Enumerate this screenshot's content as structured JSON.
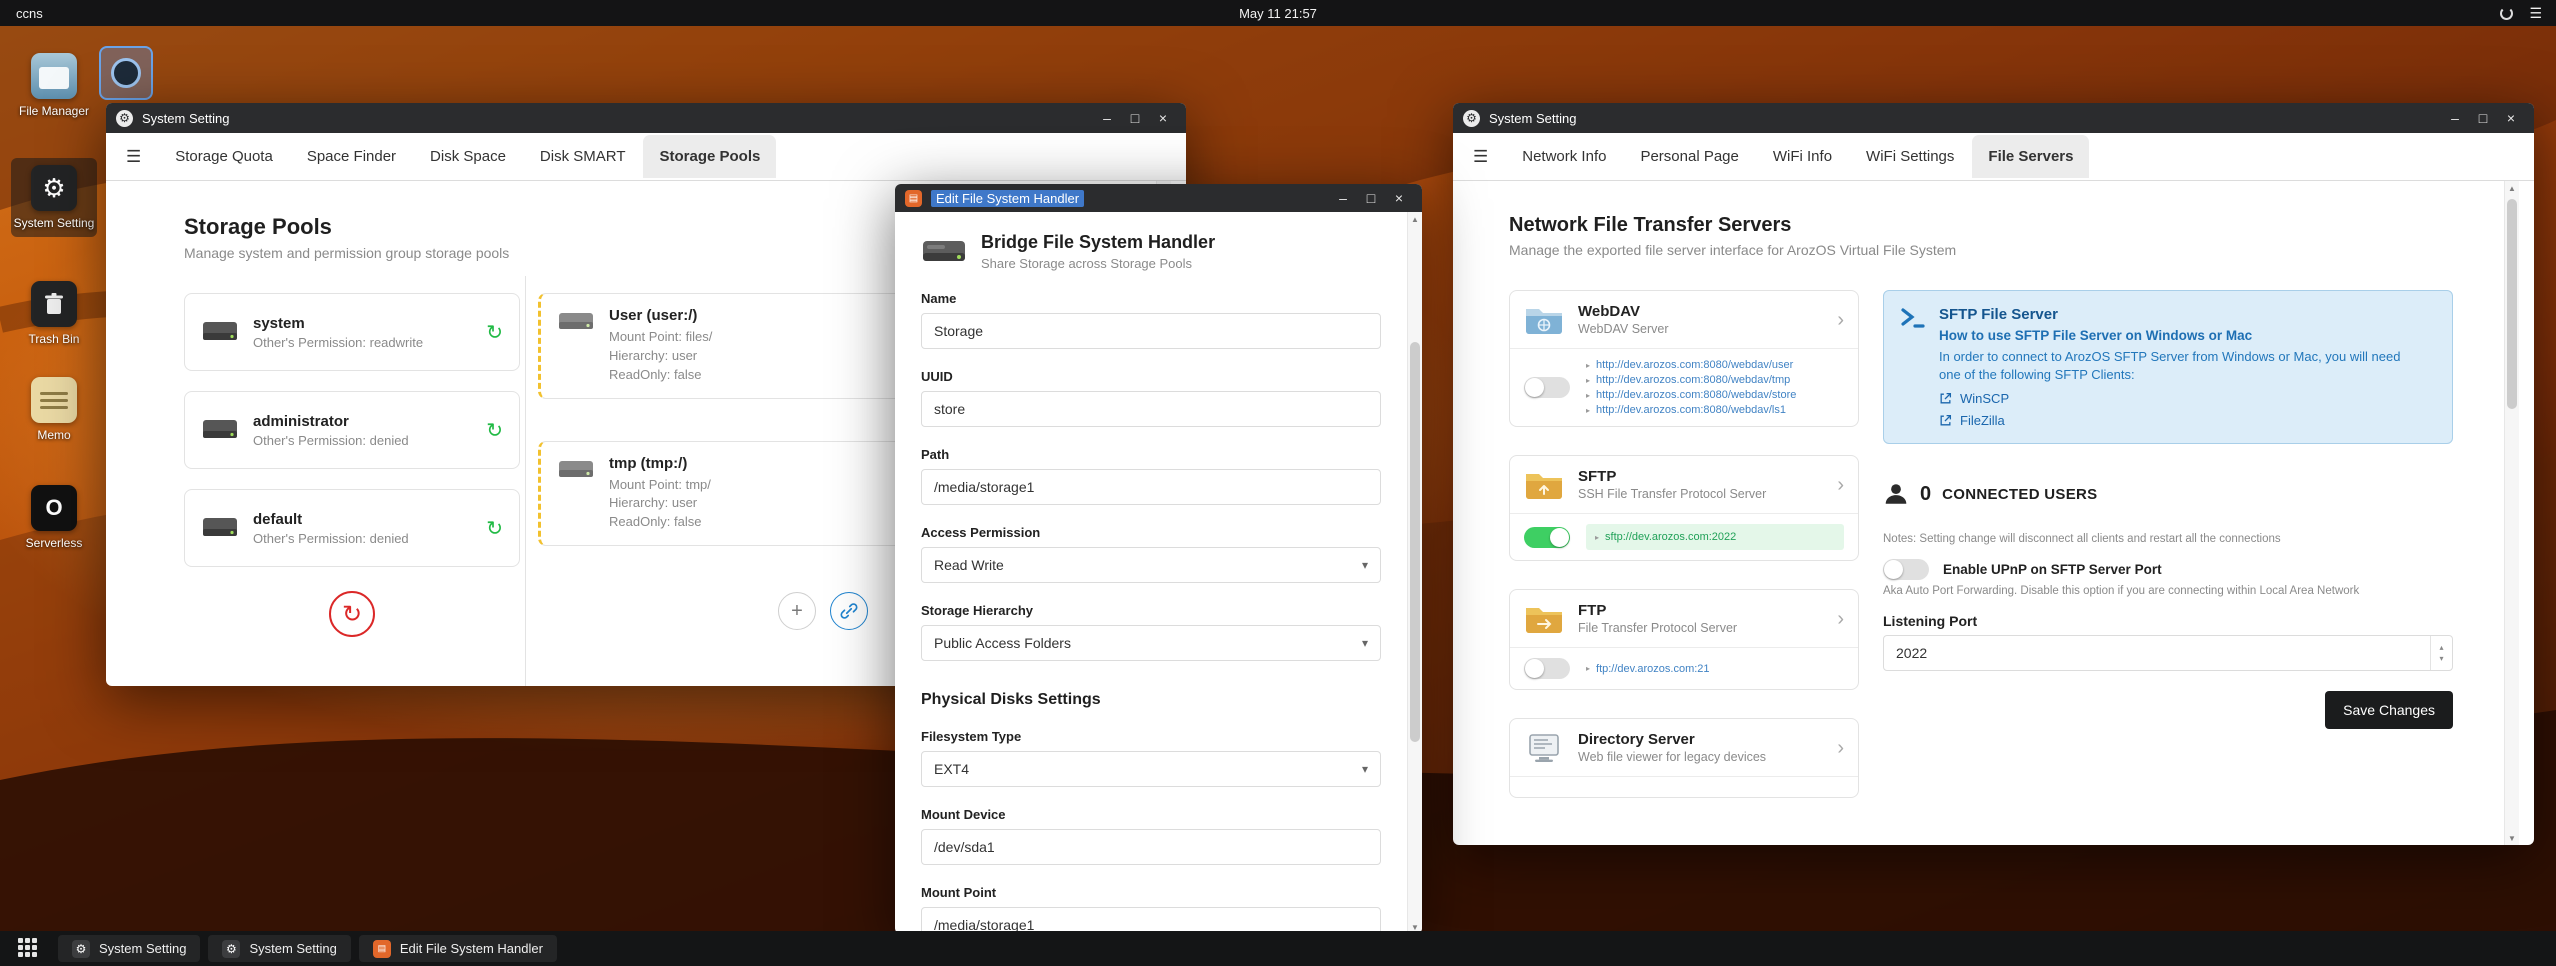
{
  "glyphs": {
    "hamburger": "☰",
    "gear": "⚙",
    "refresh": "↻",
    "sync": "↻",
    "close": "×",
    "minimize": "–",
    "maximize": "□",
    "plus": "+",
    "caret": "▾",
    "chevron": "›",
    "bullet": "▸",
    "spin_up": "▴",
    "spin_down": "▾",
    "scroll_up": "▲",
    "scroll_down": "▼",
    "serverless_glyph": "O"
  },
  "colors": {
    "accent_green": "#21ba45",
    "accent_red": "#db2828",
    "accent_blue": "#2185d0",
    "link_blue": "#4183c4",
    "toggle_on": "#3ecf63",
    "info_box_bg": "#dcedf9",
    "save_button_bg": "#1b1c1d"
  },
  "topbar": {
    "menu_label": "ccns",
    "clock": "May 11 21:57"
  },
  "desktop": {
    "icons": [
      {
        "label": "File Manager"
      },
      {
        "label": "System Setting"
      },
      {
        "label": "Trash Bin"
      },
      {
        "label": "Memo"
      },
      {
        "label": "Serverless"
      }
    ]
  },
  "window_storage": {
    "title": "System Setting",
    "tabs": [
      "Storage Quota",
      "Space Finder",
      "Disk Space",
      "Disk SMART",
      "Storage Pools"
    ],
    "heading": "Storage Pools",
    "subheading": "Manage system and permission group storage pools",
    "pools": [
      {
        "name": "system",
        "desc": "Other's Permission: readwrite"
      },
      {
        "name": "administrator",
        "desc": "Other's Permission: denied"
      },
      {
        "name": "default",
        "desc": "Other's Permission: denied"
      }
    ],
    "mounts": [
      {
        "name": "User (user:/)",
        "line1": "Mount Point: files/",
        "line2": "Hierarchy: user",
        "line3": "ReadOnly: false"
      },
      {
        "name": "tmp (tmp:/)",
        "line1": "Mount Point: tmp/",
        "line2": "Hierarchy: user",
        "line3": "ReadOnly: false"
      }
    ]
  },
  "window_editor": {
    "title": "Edit File System Handler",
    "heading": "Bridge File System Handler",
    "subheading": "Share Storage across Storage Pools",
    "section": "Physical Disks Settings",
    "fields": {
      "name": {
        "label": "Name",
        "value": "Storage"
      },
      "uuid": {
        "label": "UUID",
        "value": "store"
      },
      "path": {
        "label": "Path",
        "value": "/media/storage1"
      },
      "access": {
        "label": "Access Permission",
        "value": "Read Write"
      },
      "hierarchy": {
        "label": "Storage Hierarchy",
        "value": "Public Access Folders"
      },
      "fstype": {
        "label": "Filesystem Type",
        "value": "EXT4"
      },
      "mount_device": {
        "label": "Mount Device",
        "value": "/dev/sda1"
      },
      "mount_point": {
        "label": "Mount Point",
        "value": "/media/storage1"
      }
    }
  },
  "window_servers": {
    "title": "System Setting",
    "tabs": [
      "Network Info",
      "Personal Page",
      "WiFi Info",
      "WiFi Settings",
      "File Servers"
    ],
    "heading": "Network File Transfer Servers",
    "subheading": "Manage the exported file server interface for ArozOS Virtual File System",
    "webdav": {
      "name": "WebDAV",
      "desc": "WebDAV Server",
      "links": [
        "http://dev.arozos.com:8080/webdav/user",
        "http://dev.arozos.com:8080/webdav/tmp",
        "http://dev.arozos.com:8080/webdav/store",
        "http://dev.arozos.com:8080/webdav/ls1"
      ]
    },
    "sftp": {
      "name": "SFTP",
      "desc": "SSH File Transfer Protocol Server",
      "link": "sftp://dev.arozos.com:2022"
    },
    "ftp": {
      "name": "FTP",
      "desc": "File Transfer Protocol Server",
      "link": "ftp://dev.arozos.com:21"
    },
    "directory": {
      "name": "Directory Server",
      "desc": "Web file viewer for legacy devices"
    },
    "sftp_info": {
      "title": "SFTP File Server",
      "subtitle": "How to use SFTP File Server on Windows or Mac",
      "body": "In order to connect to ArozOS SFTP Server from Windows or Mac, you will need one of the following SFTP Clients:",
      "client1": "WinSCP",
      "client2": "FileZilla"
    },
    "connected": {
      "count": "0",
      "label": "CONNECTED USERS"
    },
    "notes": "Notes: Setting change will disconnect all clients and restart all the connections",
    "upnp": {
      "label": "Enable UPnP on SFTP Server Port",
      "desc": "Aka Auto Port Forwarding. Disable this option if you are connecting within Local Area Network"
    },
    "port": {
      "label": "Listening Port",
      "value": "2022"
    },
    "save_label": "Save Changes"
  },
  "taskbar": {
    "items": [
      {
        "label": "System Setting"
      },
      {
        "label": "System Setting"
      },
      {
        "label": "Edit File System Handler"
      }
    ]
  }
}
